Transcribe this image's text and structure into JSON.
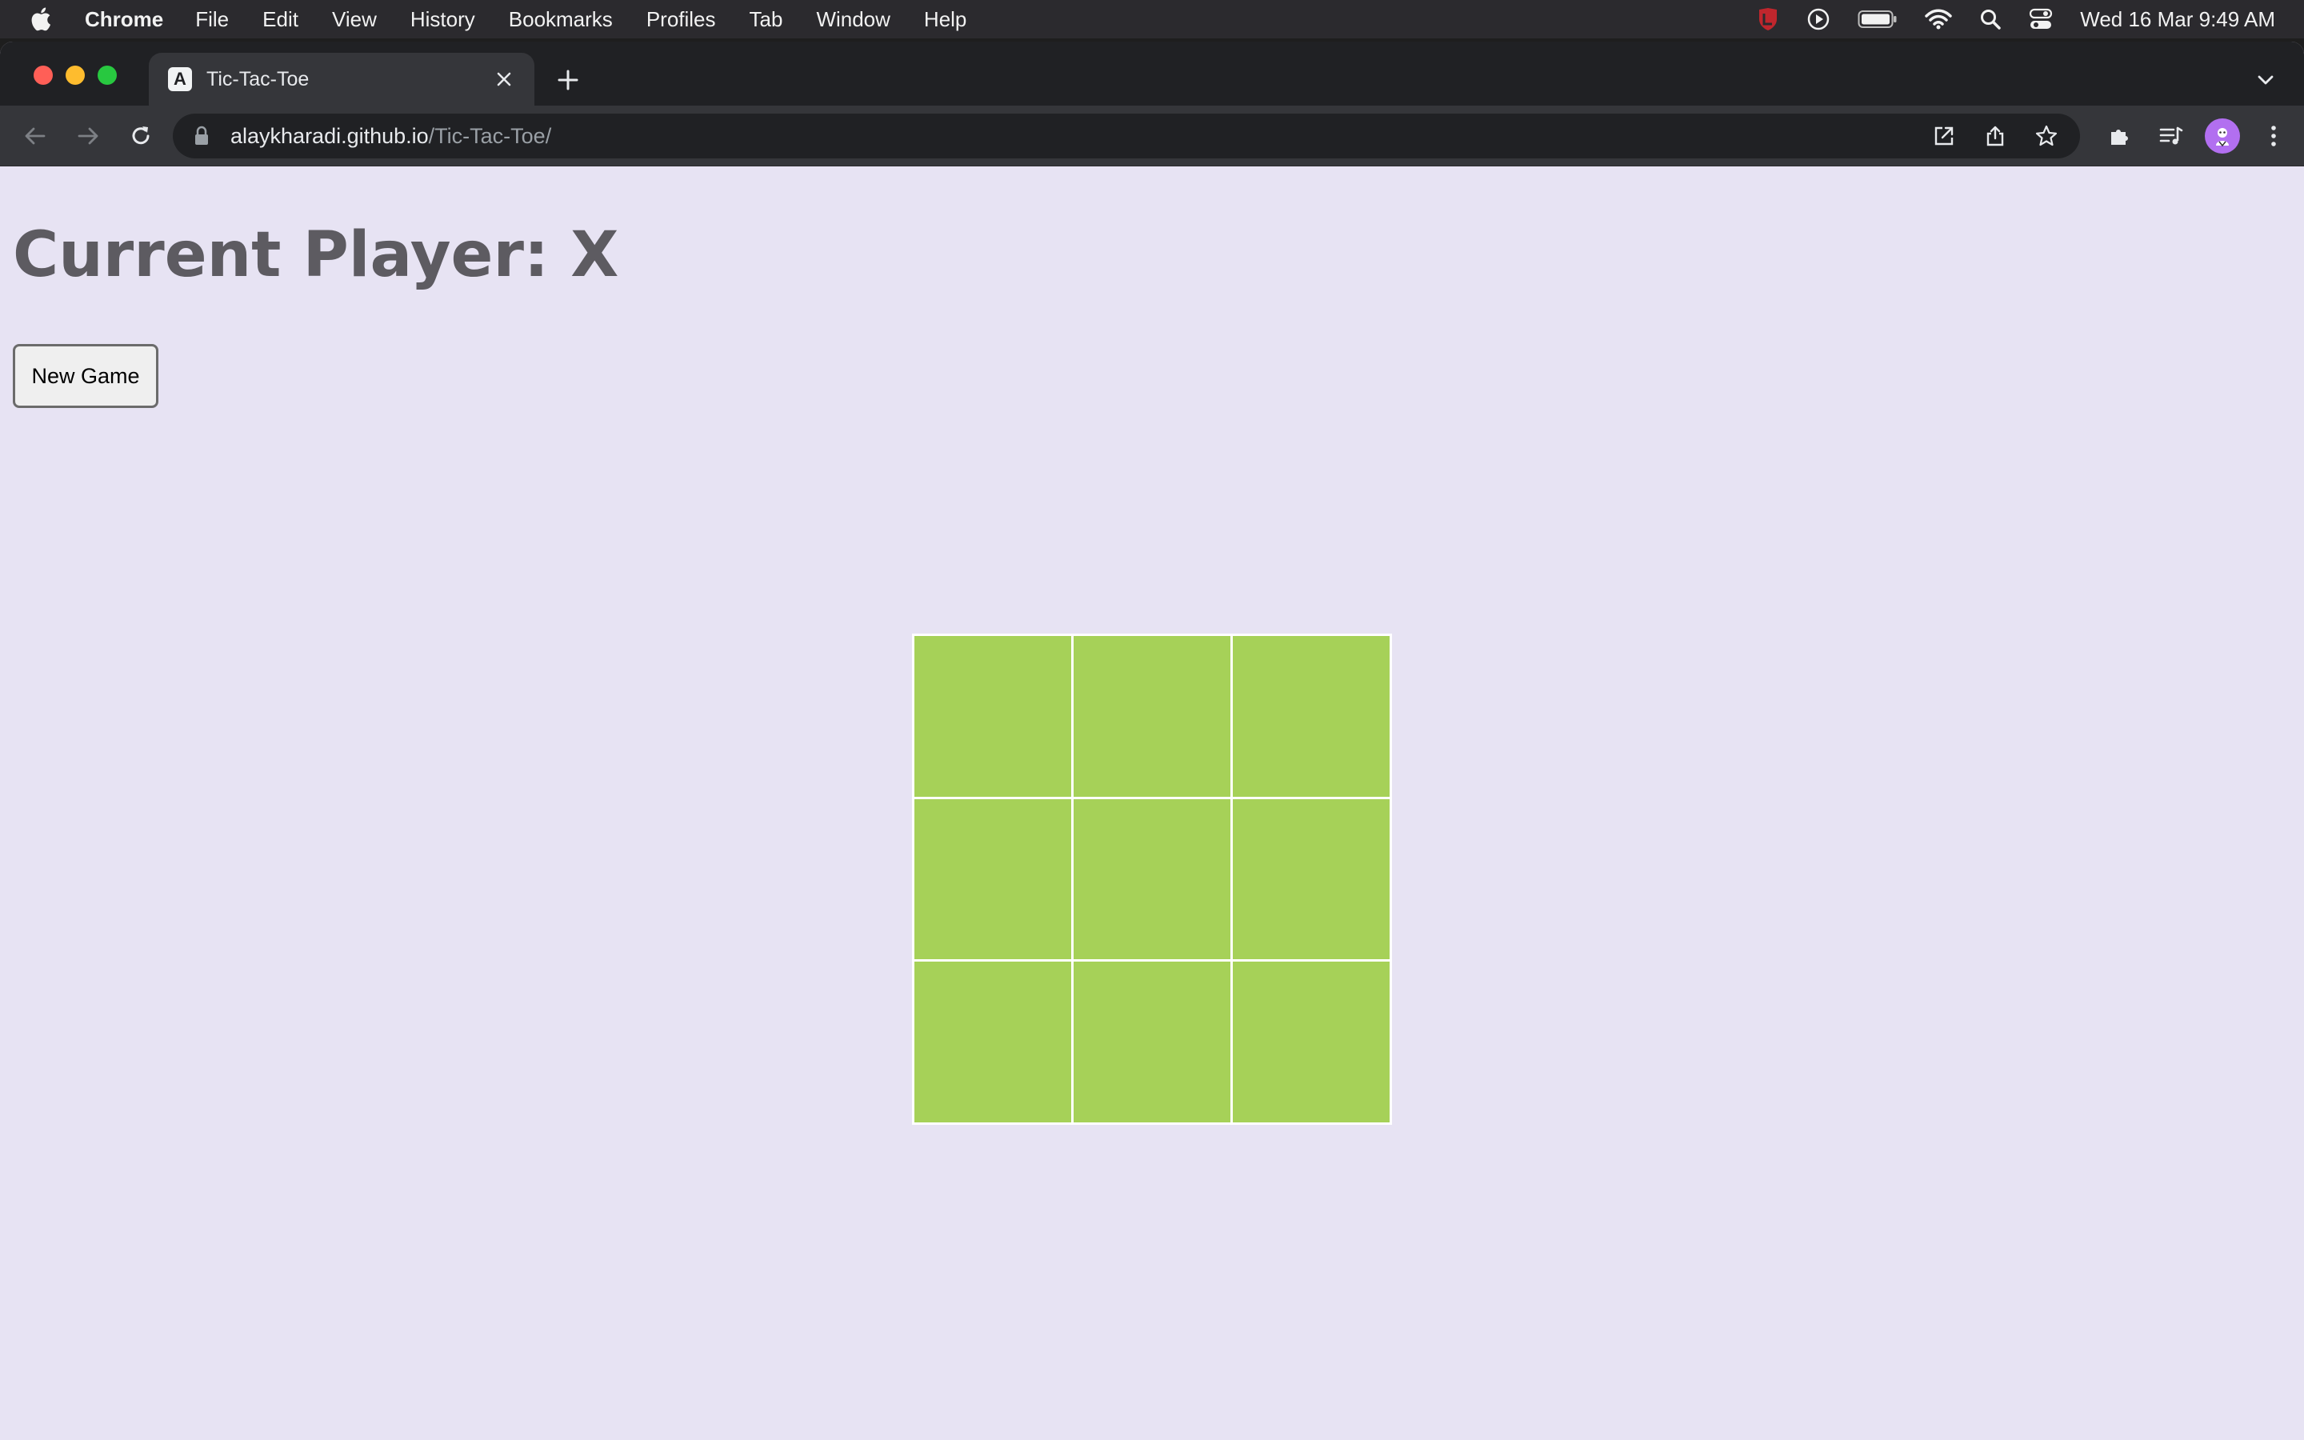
{
  "menubar": {
    "app_name": "Chrome",
    "items": [
      "File",
      "Edit",
      "View",
      "History",
      "Bookmarks",
      "Profiles",
      "Tab",
      "Window",
      "Help"
    ],
    "clock": "Wed 16 Mar  9:49 AM"
  },
  "browser": {
    "tab": {
      "title": "Tic-Tac-Toe",
      "favicon_letter": "A"
    },
    "url": {
      "host": "alaykharadi.github.io",
      "path": "/Tic-Tac-Toe/"
    }
  },
  "page": {
    "status": "Current Player: X",
    "new_game_label": "New Game",
    "board": {
      "cells": [
        "",
        "",
        "",
        "",
        "",
        "",
        "",
        "",
        ""
      ],
      "cell_color": "#a6d158"
    },
    "background_color": "#e7e3f3"
  }
}
